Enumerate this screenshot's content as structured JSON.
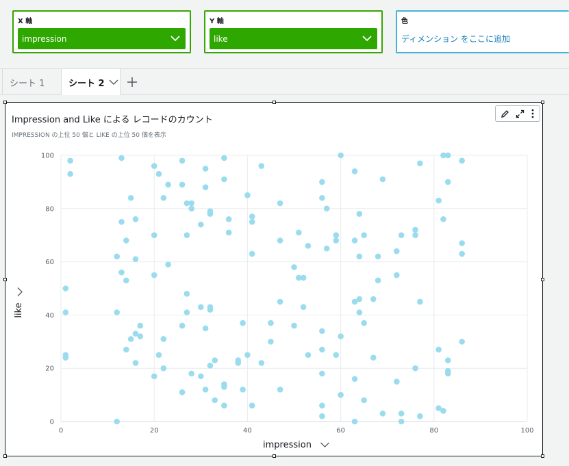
{
  "fieldwells": {
    "x": {
      "label": "X 軸",
      "value": "impression"
    },
    "y": {
      "label": "Y 軸",
      "value": "like"
    },
    "color": {
      "label": "色",
      "placeholder": "ディメンション をここに追加"
    }
  },
  "tabs": {
    "sheet1": "シート 1",
    "sheet2": "シート 2"
  },
  "visual": {
    "title": "Impression and Like による レコードのカウント",
    "subtitle": "IMPRESSION の上位 50 個と LIKE の上位 50 個を表示"
  },
  "colors": {
    "point": "#9adcee",
    "grid": "#e9ebed",
    "accent_green": "#2ea800"
  },
  "chart_data": {
    "type": "scatter",
    "xlabel": "impression",
    "ylabel": "like",
    "xlim": [
      0,
      100
    ],
    "ylim": [
      0,
      100
    ],
    "xticks": [
      "0",
      "20",
      "40",
      "60",
      "80",
      "100"
    ],
    "yticks": [
      "0",
      "20",
      "40",
      "60",
      "80",
      "100"
    ],
    "grid": true,
    "points": [
      [
        1,
        50
      ],
      [
        1,
        41
      ],
      [
        1,
        25
      ],
      [
        1,
        24
      ],
      [
        2,
        98
      ],
      [
        2,
        93
      ],
      [
        12,
        62
      ],
      [
        12,
        41
      ],
      [
        12,
        0
      ],
      [
        13,
        99
      ],
      [
        13,
        75
      ],
      [
        13,
        56
      ],
      [
        14,
        68
      ],
      [
        14,
        53
      ],
      [
        14,
        27
      ],
      [
        15,
        84
      ],
      [
        15,
        31
      ],
      [
        16,
        76
      ],
      [
        16,
        61
      ],
      [
        16,
        33
      ],
      [
        16,
        22
      ],
      [
        17,
        36
      ],
      [
        17,
        32
      ],
      [
        20,
        96
      ],
      [
        20,
        70
      ],
      [
        20,
        55
      ],
      [
        20,
        17
      ],
      [
        21,
        93
      ],
      [
        21,
        25
      ],
      [
        22,
        84
      ],
      [
        22,
        31
      ],
      [
        22,
        20
      ],
      [
        23,
        89
      ],
      [
        23,
        59
      ],
      [
        26,
        98
      ],
      [
        26,
        89
      ],
      [
        26,
        36
      ],
      [
        26,
        11
      ],
      [
        27,
        82
      ],
      [
        27,
        70
      ],
      [
        27,
        48
      ],
      [
        27,
        41
      ],
      [
        28,
        82
      ],
      [
        28,
        80
      ],
      [
        28,
        18
      ],
      [
        30,
        74
      ],
      [
        30,
        43
      ],
      [
        30,
        17
      ],
      [
        31,
        95
      ],
      [
        31,
        88
      ],
      [
        31,
        35
      ],
      [
        31,
        12
      ],
      [
        32,
        79
      ],
      [
        32,
        78
      ],
      [
        32,
        43
      ],
      [
        32,
        42
      ],
      [
        32,
        21
      ],
      [
        33,
        23
      ],
      [
        33,
        8
      ],
      [
        35,
        99
      ],
      [
        35,
        91
      ],
      [
        35,
        14
      ],
      [
        35,
        13
      ],
      [
        35,
        6
      ],
      [
        36,
        76
      ],
      [
        36,
        71
      ],
      [
        38,
        23
      ],
      [
        38,
        22
      ],
      [
        39,
        37
      ],
      [
        39,
        12
      ],
      [
        40,
        85
      ],
      [
        40,
        25
      ],
      [
        41,
        77
      ],
      [
        41,
        75
      ],
      [
        41,
        63
      ],
      [
        41,
        6
      ],
      [
        43,
        96
      ],
      [
        43,
        22
      ],
      [
        45,
        37
      ],
      [
        45,
        30
      ],
      [
        47,
        82
      ],
      [
        47,
        68
      ],
      [
        47,
        45
      ],
      [
        47,
        12
      ],
      [
        50,
        58
      ],
      [
        50,
        36
      ],
      [
        51,
        71
      ],
      [
        51,
        54
      ],
      [
        52,
        54
      ],
      [
        52,
        43
      ],
      [
        53,
        66
      ],
      [
        53,
        25
      ],
      [
        56,
        90
      ],
      [
        56,
        84
      ],
      [
        56,
        34
      ],
      [
        56,
        27
      ],
      [
        56,
        18
      ],
      [
        56,
        6
      ],
      [
        56,
        2
      ],
      [
        57,
        80
      ],
      [
        57,
        65
      ],
      [
        59,
        70
      ],
      [
        59,
        68
      ],
      [
        59,
        25
      ],
      [
        60,
        100
      ],
      [
        60,
        32
      ],
      [
        60,
        10
      ],
      [
        63,
        94
      ],
      [
        63,
        68
      ],
      [
        63,
        45
      ],
      [
        63,
        16
      ],
      [
        63,
        0
      ],
      [
        64,
        78
      ],
      [
        64,
        62
      ],
      [
        64,
        46
      ],
      [
        64,
        41
      ],
      [
        65,
        70
      ],
      [
        65,
        37
      ],
      [
        65,
        8
      ],
      [
        67,
        46
      ],
      [
        67,
        24
      ],
      [
        68,
        62
      ],
      [
        68,
        53
      ],
      [
        69,
        91
      ],
      [
        69,
        3
      ],
      [
        72,
        64
      ],
      [
        72,
        55
      ],
      [
        72,
        15
      ],
      [
        73,
        70
      ],
      [
        73,
        3
      ],
      [
        73,
        0
      ],
      [
        76,
        72
      ],
      [
        76,
        70
      ],
      [
        76,
        20
      ],
      [
        77,
        97
      ],
      [
        77,
        45
      ],
      [
        77,
        2
      ],
      [
        81,
        83
      ],
      [
        81,
        27
      ],
      [
        81,
        5
      ],
      [
        82,
        100
      ],
      [
        82,
        76
      ],
      [
        82,
        4
      ],
      [
        83,
        100
      ],
      [
        83,
        90
      ],
      [
        83,
        23
      ],
      [
        83,
        19
      ],
      [
        83,
        18
      ],
      [
        86,
        98
      ],
      [
        86,
        67
      ],
      [
        86,
        63
      ],
      [
        86,
        30
      ]
    ]
  }
}
